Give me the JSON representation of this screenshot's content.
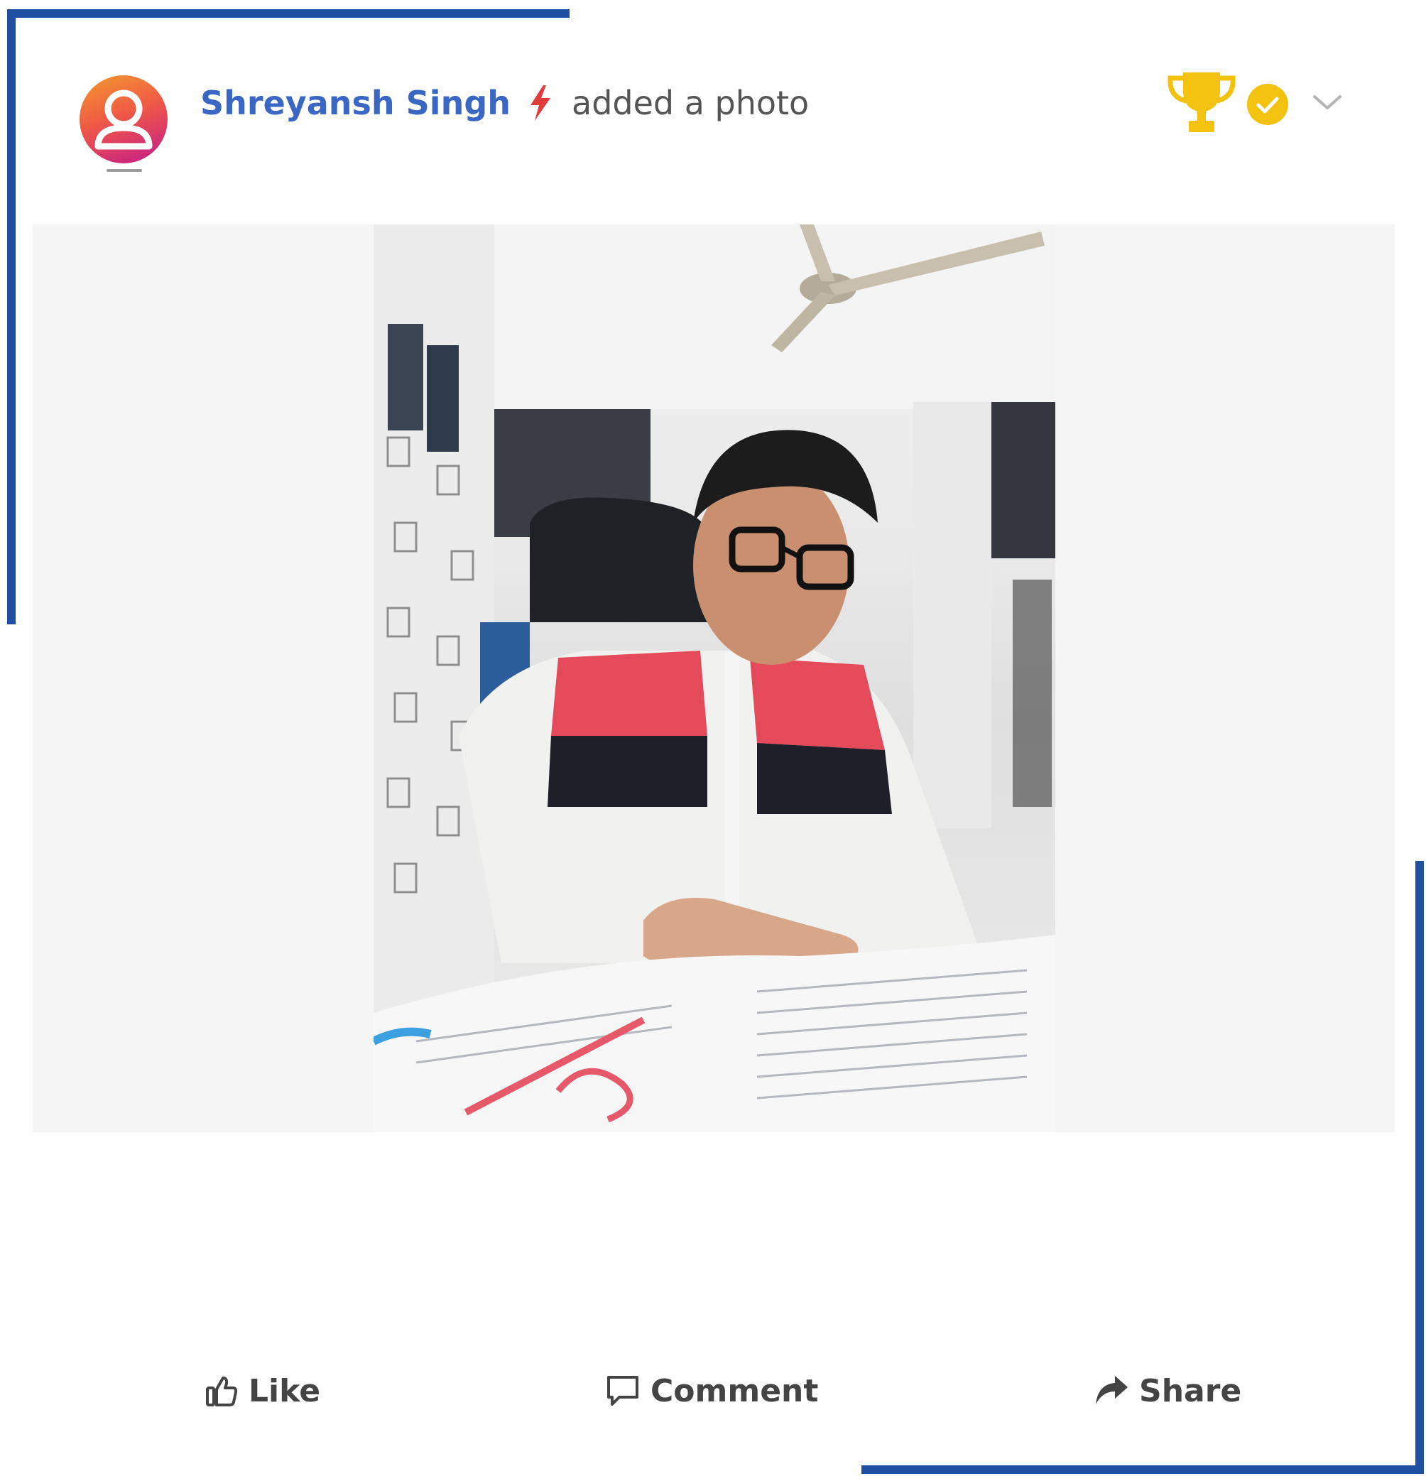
{
  "post": {
    "author_name": "Shreyansh Singh",
    "action_text": "added a photo"
  },
  "actions": {
    "like_label": "Like",
    "comment_label": "Comment",
    "share_label": "Share"
  },
  "icons": {
    "avatar": "user-avatar-icon",
    "bolt": "lightning-bolt-icon",
    "trophy": "trophy-icon",
    "verified": "verified-check-icon",
    "menu": "chevron-down-icon",
    "like": "thumbs-up-icon",
    "comment": "comment-icon",
    "share": "share-arrow-icon"
  },
  "colors": {
    "frame": "#1f4fa0",
    "author": "#3a66c4",
    "bolt": "#e23d3d",
    "trophy": "#f2c20f",
    "verified": "#f2c20f",
    "photo_panel": "#f5f5f5",
    "action_text": "#444444"
  }
}
